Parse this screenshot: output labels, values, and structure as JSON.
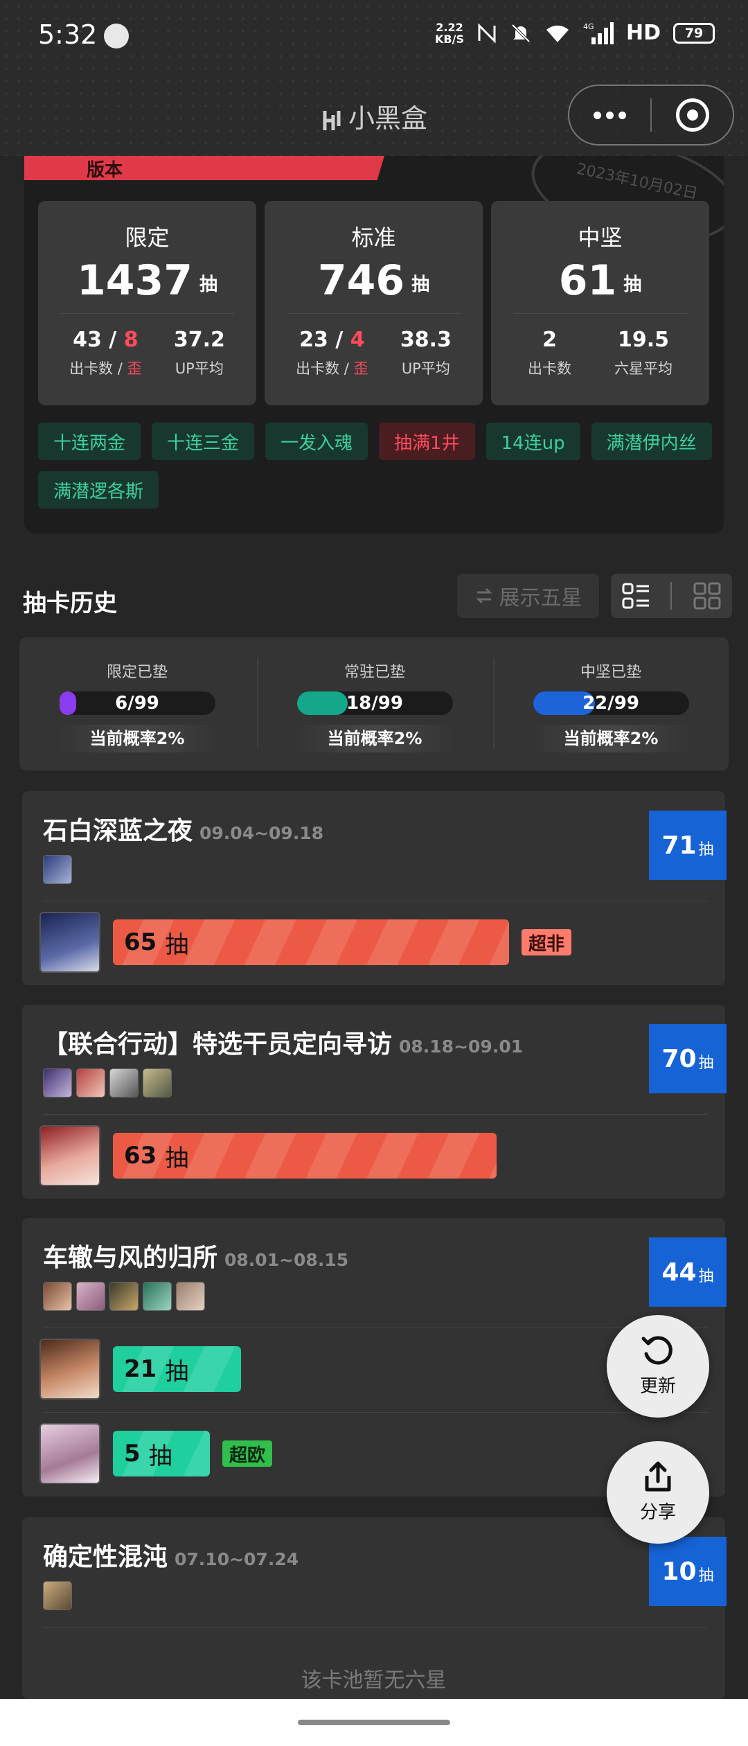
{
  "status_bar": {
    "time": "5:32",
    "net_speed_top": "2.22",
    "net_speed_bottom": "KB/S",
    "network": "4G",
    "hd": "HD",
    "battery": "79"
  },
  "app": {
    "logo_text": "小黑盒"
  },
  "version": {
    "label": "版本",
    "stamp_text": "2023年10月02日"
  },
  "stats": [
    {
      "title": "限定",
      "total": "1437",
      "unit": "抽",
      "left_value": "43",
      "left_slash": " / ",
      "left_red": "8",
      "left_label": "出卡数 / ",
      "left_label_red": "歪",
      "right_value": "37.2",
      "right_label": "UP平均"
    },
    {
      "title": "标准",
      "total": "746",
      "unit": "抽",
      "left_value": "23",
      "left_slash": " / ",
      "left_red": "4",
      "left_label": "出卡数 / ",
      "left_label_red": "歪",
      "right_value": "38.3",
      "right_label": "UP平均"
    },
    {
      "title": "中坚",
      "total": "61",
      "unit": "抽",
      "left_value": "2",
      "left_slash": "",
      "left_red": "",
      "left_label": "出卡数",
      "left_label_red": "",
      "right_value": "19.5",
      "right_label": "六星平均"
    }
  ],
  "tags": [
    {
      "text": "十连两金",
      "type": "good"
    },
    {
      "text": "十连三金",
      "type": "good"
    },
    {
      "text": "一发入魂",
      "type": "good"
    },
    {
      "text": "抽满1井",
      "type": "bad"
    },
    {
      "text": "14连up",
      "type": "good"
    },
    {
      "text": "满潜伊内丝",
      "type": "good"
    },
    {
      "text": "满潜逻各斯",
      "type": "good"
    }
  ],
  "history": {
    "title": "抽卡历史",
    "show_five_star": "展示五星"
  },
  "pity": [
    {
      "label": "限定已垫",
      "value": "6/99",
      "progress": 0.06,
      "color": "#8a3cf0",
      "rate": "当前概率2%"
    },
    {
      "label": "常驻已垫",
      "value": "18/99",
      "progress": 0.18,
      "color": "#14a88a",
      "rate": "当前概率2%"
    },
    {
      "label": "中坚已垫",
      "value": "22/99",
      "progress": 0.22,
      "color": "#1c64d8",
      "rate": "当前概率2%"
    }
  ],
  "pools": [
    {
      "name": "石白深蓝之夜",
      "date": "09.04~09.18",
      "count": "71",
      "unit": "抽",
      "pulls": [
        {
          "count": "65",
          "unit": "抽",
          "fraction": 0.65,
          "color": "red",
          "pill": "超非",
          "pill_type": "fei"
        }
      ]
    },
    {
      "name": "【联合行动】特选干员定向寻访",
      "date": "08.18~09.01",
      "count": "70",
      "unit": "抽",
      "pulls": [
        {
          "count": "63",
          "unit": "抽",
          "fraction": 0.63,
          "color": "red",
          "pill": "",
          "pill_type": ""
        }
      ]
    },
    {
      "name": "车辙与风的归所",
      "date": "08.01~08.15",
      "count": "44",
      "unit": "抽",
      "pulls": [
        {
          "count": "21",
          "unit": "抽",
          "fraction": 0.21,
          "color": "green",
          "pill": "",
          "pill_type": ""
        },
        {
          "count": "5",
          "unit": "抽",
          "fraction": 0.05,
          "color": "green",
          "pill": "超欧",
          "pill_type": "ou"
        }
      ]
    },
    {
      "name": "确定性混沌",
      "date": "07.10~07.24",
      "count": "10",
      "unit": "抽",
      "empty_note": "该卡池暂无六星"
    }
  ],
  "fabs": {
    "refresh": "更新",
    "share": "分享"
  },
  "colors": {
    "accent_blue": "#1663d6",
    "bad_red": "#ff4b5c",
    "good_green": "#3ccf9d"
  }
}
